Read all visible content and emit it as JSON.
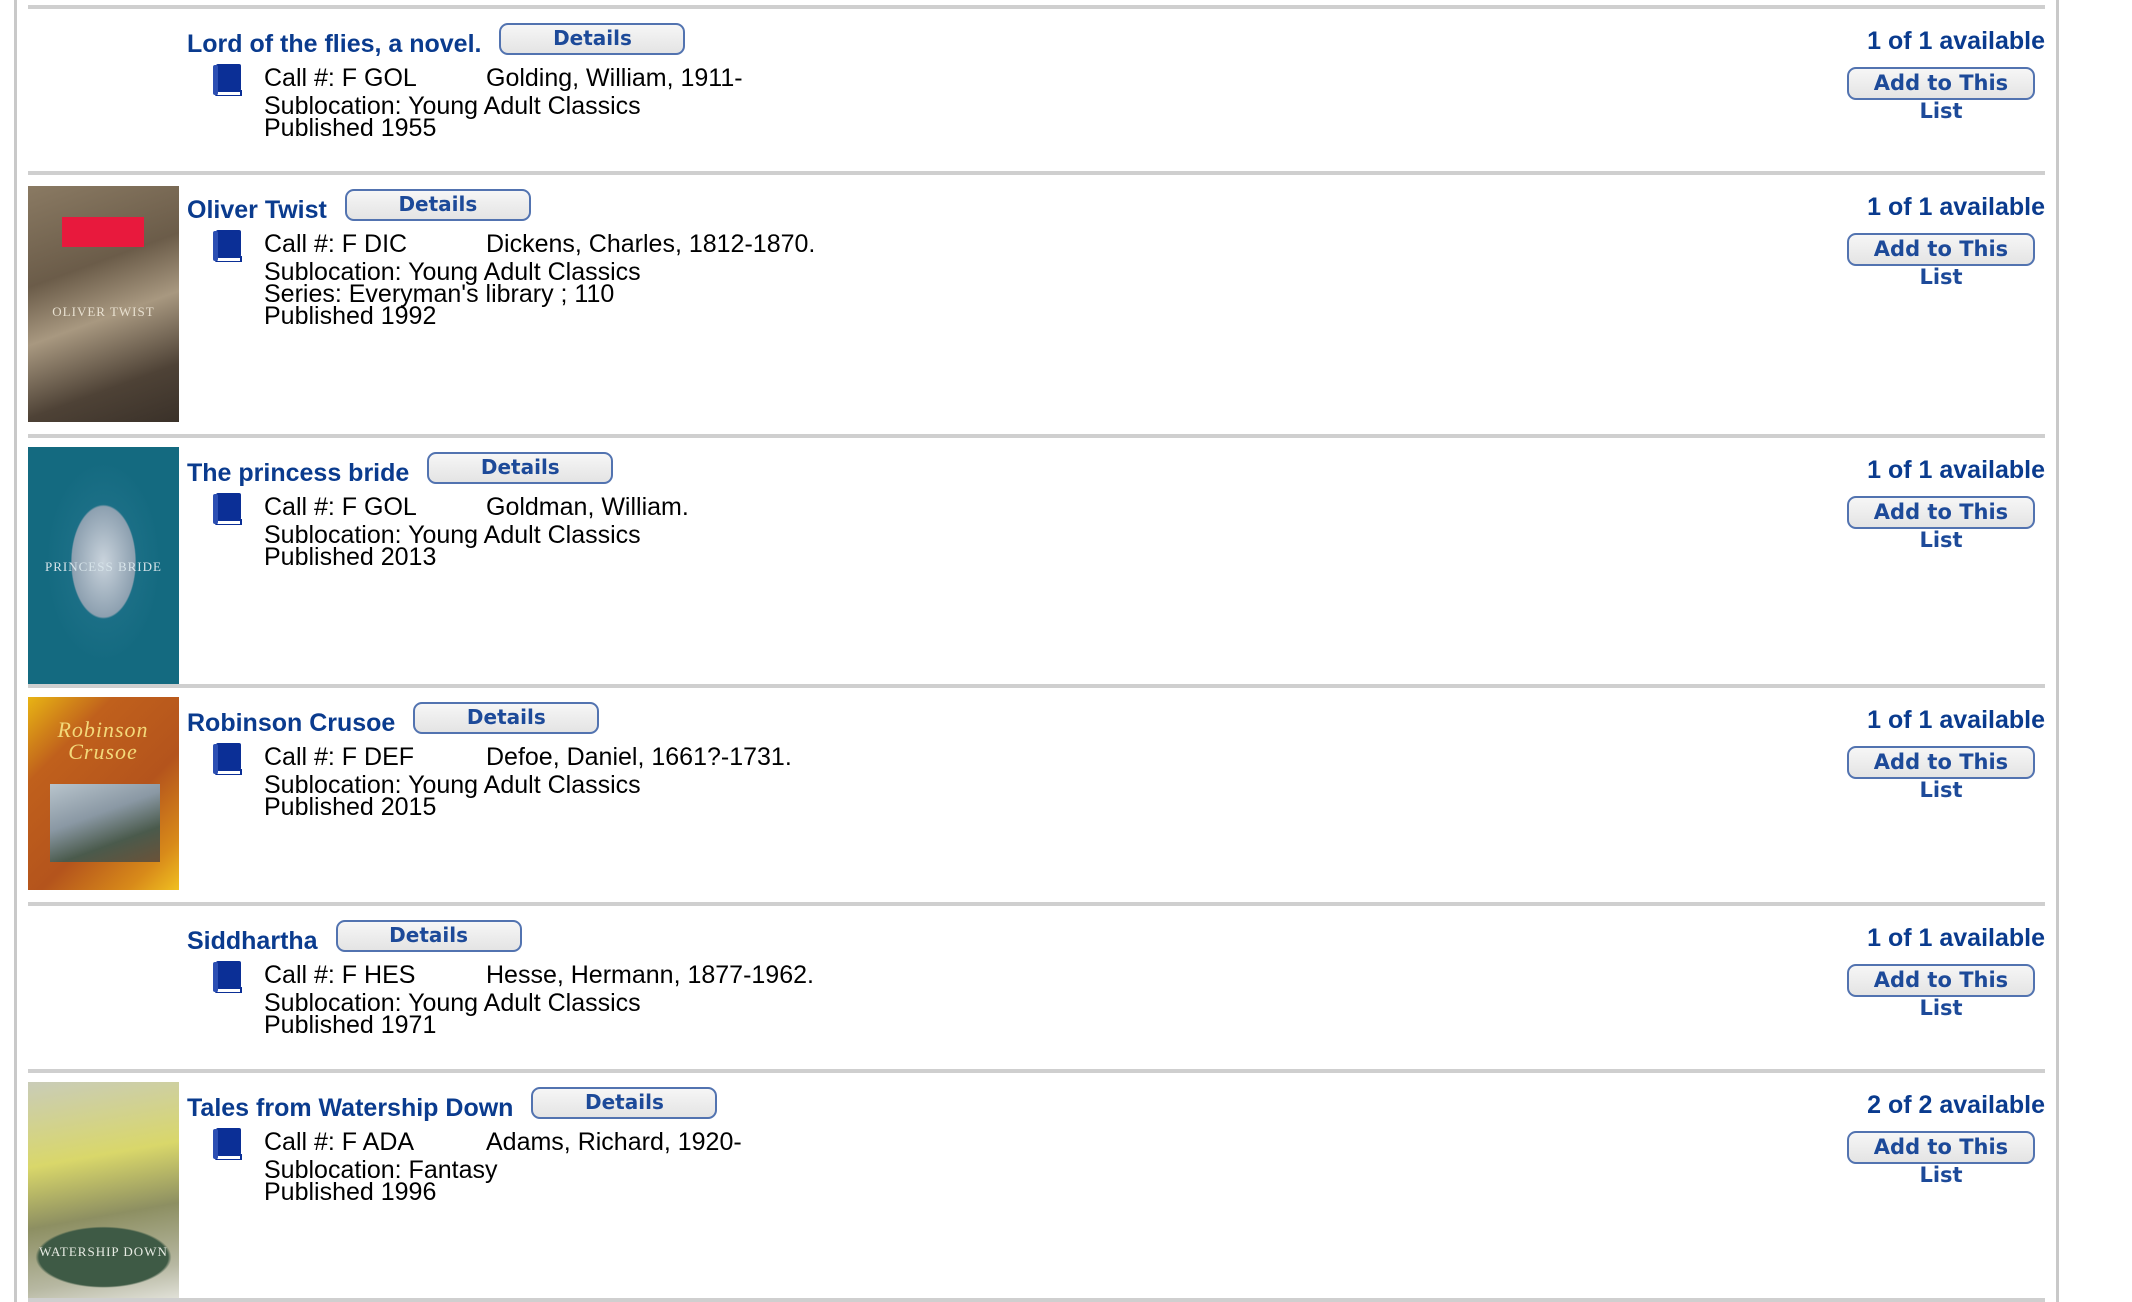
{
  "results": [
    {
      "title": "Lord of the flies, a novel.",
      "details_label": "Details",
      "call_number": "Call #: F GOL",
      "author": "Golding, William, 1911-",
      "sublocation": "Sublocation: Young Adult Classics",
      "series": null,
      "published": "Published 1955",
      "availability": "1 of 1 available",
      "add_label": "Add to This List",
      "format_icon": "book-icon",
      "cover": null
    },
    {
      "title": "Oliver Twist",
      "details_label": "Details",
      "call_number": "Call #: F DIC",
      "author": "Dickens, Charles, 1812-1870.",
      "sublocation": "Sublocation: Young Adult Classics",
      "series": "Series: Everyman's library ; 110",
      "published": "Published 1992",
      "availability": "1 of 1 available",
      "add_label": "Add to This List",
      "format_icon": "book-icon",
      "cover": {
        "style": "oliver",
        "text": "OLIVER TWIST"
      }
    },
    {
      "title": "The princess bride",
      "details_label": "Details",
      "call_number": "Call #: F GOL",
      "author": "Goldman, William.",
      "sublocation": "Sublocation: Young Adult Classics",
      "series": null,
      "published": "Published 2013",
      "availability": "1 of 1 available",
      "add_label": "Add to This List",
      "format_icon": "book-icon",
      "cover": {
        "style": "princess",
        "text": "PRINCESS BRIDE"
      }
    },
    {
      "title": "Robinson Crusoe",
      "details_label": "Details",
      "call_number": "Call #: F DEF",
      "author": "Defoe, Daniel, 1661?-1731.",
      "sublocation": "Sublocation: Young Adult Classics",
      "series": null,
      "published": "Published 2015",
      "availability": "1 of 1 available",
      "add_label": "Add to This List",
      "format_icon": "book-icon",
      "cover": {
        "style": "crusoe",
        "text": "Robinson Crusoe"
      }
    },
    {
      "title": "Siddhartha",
      "details_label": "Details",
      "call_number": "Call #: F HES",
      "author": "Hesse, Hermann, 1877-1962.",
      "sublocation": "Sublocation: Young Adult Classics",
      "series": null,
      "published": "Published 1971",
      "availability": "1 of 1 available",
      "add_label": "Add to This List",
      "format_icon": "book-icon",
      "cover": null
    },
    {
      "title": "Tales from Watership Down",
      "details_label": "Details",
      "call_number": "Call #: F ADA",
      "author": "Adams, Richard, 1920-",
      "sublocation": "Sublocation: Fantasy",
      "series": null,
      "published": "Published 1996",
      "availability": "2 of 2 available",
      "add_label": "Add to This List",
      "format_icon": "book-icon",
      "cover": {
        "style": "watership",
        "text": "WATERSHIP DOWN"
      }
    }
  ],
  "colors": {
    "link": "#0a3b8e",
    "button_border": "#5273b0",
    "divider": "#cfcfcf",
    "book_icon": "#0b2f96"
  }
}
